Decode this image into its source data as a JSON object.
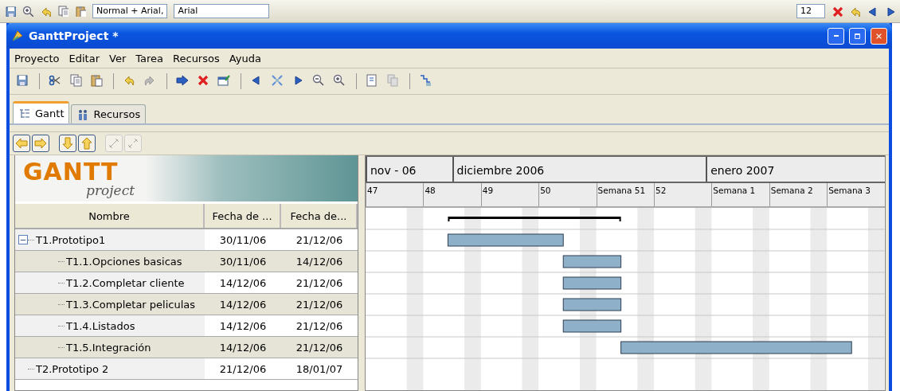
{
  "host_toolbar": {
    "style_box": "Normal + Arial,",
    "font_box": "Arial",
    "size_box": "12"
  },
  "window": {
    "title": "GanttProject *"
  },
  "menu": [
    "Proyecto",
    "Editar",
    "Ver",
    "Tarea",
    "Recursos",
    "Ayuda"
  ],
  "tabs": [
    {
      "label": "Gantt",
      "selected": true
    },
    {
      "label": "Recursos",
      "selected": false
    }
  ],
  "logo": {
    "title": "GANTT",
    "subtitle": "project"
  },
  "table": {
    "columns": [
      "Nombre",
      "Fecha de ...",
      "Fecha de..."
    ],
    "rows": [
      {
        "name": "T1.Prototipo1",
        "start": "30/11/06",
        "end": "21/12/06",
        "expanded": true,
        "children": [
          {
            "name": "T1.1.Opciones basicas",
            "start": "30/11/06",
            "end": "14/12/06"
          },
          {
            "name": "T1.2.Completar cliente",
            "start": "14/12/06",
            "end": "21/12/06"
          },
          {
            "name": "T1.3.Completar peliculas",
            "start": "14/12/06",
            "end": "21/12/06"
          },
          {
            "name": "T1.4.Listados",
            "start": "14/12/06",
            "end": "21/12/06"
          },
          {
            "name": "T1.5.Integración",
            "start": "14/12/06",
            "end": "21/12/06"
          }
        ]
      },
      {
        "name": "T2.Prototipo 2",
        "start": "21/12/06",
        "end": "18/01/07"
      }
    ]
  },
  "timeline": {
    "months": [
      "nov - 06",
      "diciembre 2006",
      "enero 2007"
    ],
    "weeks": [
      "47",
      "48",
      "49",
      "50",
      "Semana 51",
      "52",
      "Semana 1",
      "Semana 2",
      "Semana 3"
    ]
  }
}
